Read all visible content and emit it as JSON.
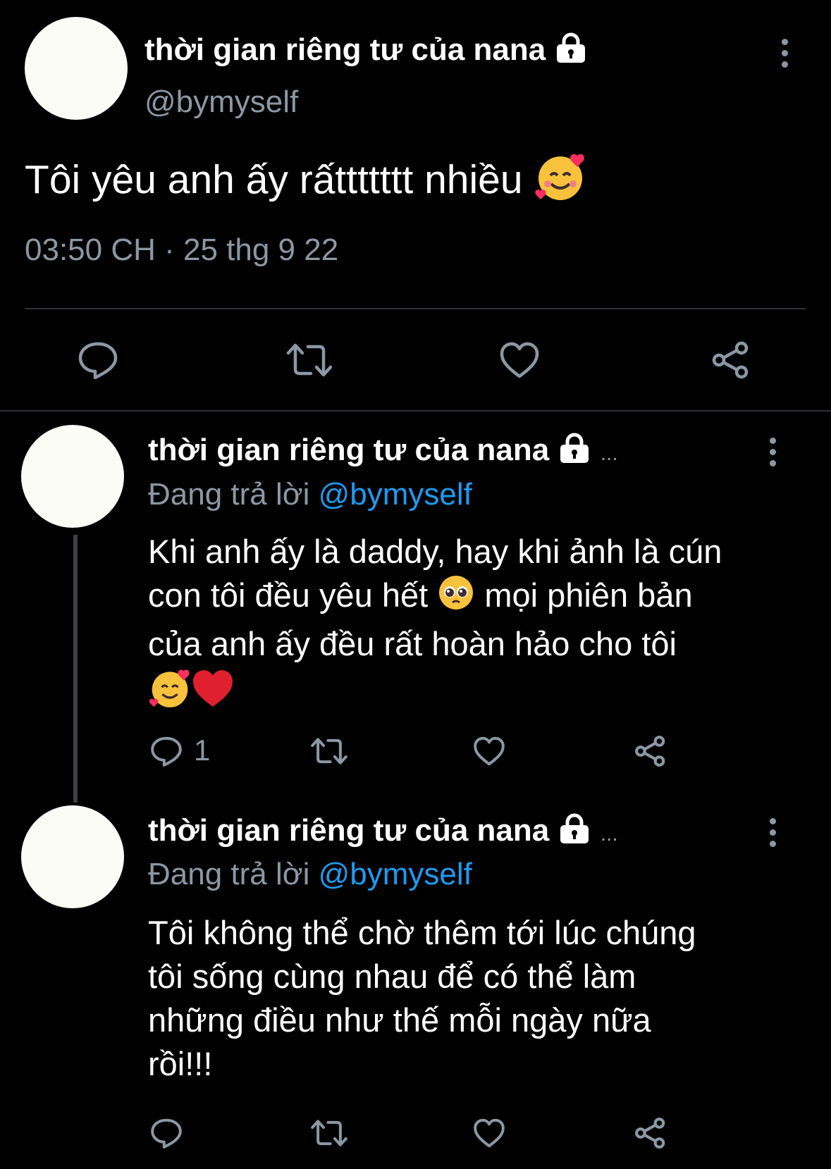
{
  "main_tweet": {
    "display_name": "thời gian riêng tư của nana",
    "handle": "@bymyself",
    "text": "Tôi yêu anh ấy rấttttttt nhiều",
    "emoji": "smiling-face-with-hearts",
    "timestamp": "03:50 CH · 25 thg 9 22",
    "actions": [
      "reply-icon",
      "retweet-icon",
      "like-icon",
      "share-icon"
    ]
  },
  "replies": [
    {
      "display_name": "thời gian riêng tư của nana",
      "truncation": "...",
      "replying_label": "Đang trả lời",
      "replying_to": "@bymyself",
      "text_lines": [
        "Khi anh ấy là daddy, hay khi ảnh là cún",
        "con tôi đều yêu hết",
        "mọi phiên bản",
        "của anh ấy đều rất hoàn hảo cho tôi"
      ],
      "emojis": [
        "pleading-face",
        "smiling-face-with-hearts",
        "red-heart"
      ],
      "reply_count": "1"
    },
    {
      "display_name": "thời gian riêng tư của nana",
      "truncation": "...",
      "replying_label": "Đang trả lời",
      "replying_to": "@bymyself",
      "text_lines": [
        "Tôi không thể chờ thêm tới lúc chúng",
        "tôi sống cùng nhau để có thể làm",
        "những điều như thế mỗi ngày nữa",
        "rồi!!!"
      ],
      "reply_count": ""
    }
  ],
  "colors": {
    "background": "#000000",
    "text": "#ffffff",
    "secondary": "#8b98a5",
    "link": "#1d9bf0",
    "divider": "#2f3336"
  }
}
